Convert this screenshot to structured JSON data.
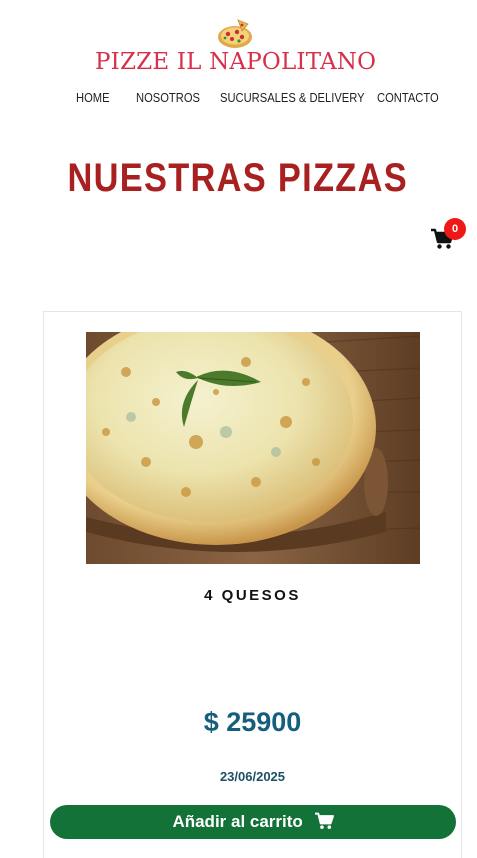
{
  "brand": {
    "name": "PIZZE IL NAPOLITANO",
    "logo_icon": "pizza-icon",
    "color": "#d6304a"
  },
  "nav": {
    "items": [
      {
        "label": "HOME"
      },
      {
        "label": "NOSOTROS"
      },
      {
        "label": "SUCURSALES & DELIVERY"
      },
      {
        "label": "CONTACTO"
      }
    ]
  },
  "page": {
    "title": "NUESTRAS PIZZAS",
    "title_color": "#a8201f"
  },
  "cart": {
    "icon": "shopping-cart-icon",
    "count": "0",
    "badge_color": "#ef1818"
  },
  "products": [
    {
      "name": "4 QUESOS",
      "image_icon": "pizza-photo",
      "price": "$ 25900",
      "date": "23/06/2025",
      "add_to_cart_label": "Añadir al carrito",
      "button_icon": "shopping-cart-icon"
    }
  ],
  "colors": {
    "price": "#165e7e",
    "button": "#127238"
  }
}
